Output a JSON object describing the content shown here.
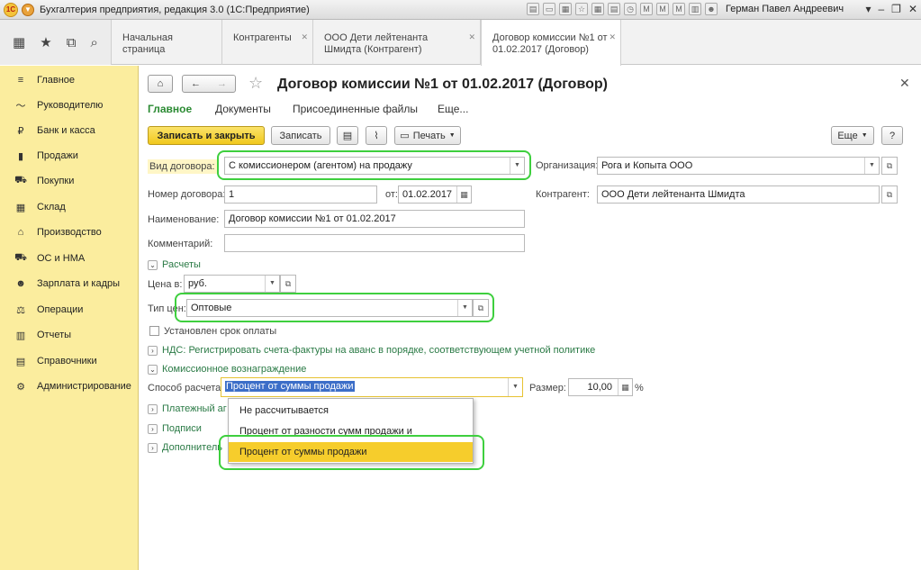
{
  "window": {
    "title": "Бухгалтерия предприятия, редакция 3.0  (1С:Предприятие)",
    "user": "Герман Павел Андреевич"
  },
  "tabs": [
    {
      "label": "Начальная страница"
    },
    {
      "label": "Контрагенты"
    },
    {
      "label": "ООО Дети лейтенанта Шмидта (Контрагент)"
    },
    {
      "label": "Договор комиссии №1 от 01.02.2017 (Договор)"
    }
  ],
  "sidebar": {
    "items": [
      {
        "label": "Главное",
        "icon": "≡"
      },
      {
        "label": "Руководителю",
        "icon": "〜"
      },
      {
        "label": "Банк и касса",
        "icon": "₽"
      },
      {
        "label": "Продажи",
        "icon": "▮"
      },
      {
        "label": "Покупки",
        "icon": "⛟"
      },
      {
        "label": "Склад",
        "icon": "▦"
      },
      {
        "label": "Производство",
        "icon": "⌂"
      },
      {
        "label": "ОС и НМА",
        "icon": "⛟"
      },
      {
        "label": "Зарплата и кадры",
        "icon": "☻"
      },
      {
        "label": "Операции",
        "icon": "⚖"
      },
      {
        "label": "Отчеты",
        "icon": "▥"
      },
      {
        "label": "Справочники",
        "icon": "▤"
      },
      {
        "label": "Администрирование",
        "icon": "⚙"
      }
    ]
  },
  "form": {
    "title": "Договор комиссии №1 от 01.02.2017 (Договор)",
    "tabs": [
      "Главное",
      "Документы",
      "Присоединенные файлы",
      "Еще..."
    ],
    "toolbar": {
      "save_close": "Записать и закрыть",
      "save": "Записать",
      "print": "Печать",
      "more": "Еще",
      "help": "?"
    },
    "contract_type": {
      "label": "Вид договора:",
      "value": "С комиссионером (агентом) на продажу"
    },
    "organization": {
      "label": "Организация:",
      "value": "Рога и Копыта ООО"
    },
    "number": {
      "label": "Номер договора:",
      "value": "1"
    },
    "date": {
      "label": "от:",
      "value": "01.02.2017"
    },
    "counterparty": {
      "label": "Контрагент:",
      "value": "ООО Дети лейтенанта Шмидта"
    },
    "name": {
      "label": "Наименование:",
      "value": "Договор комиссии №1 от 01.02.2017"
    },
    "comment": {
      "label": "Комментарий:",
      "value": ""
    },
    "group_settlements": "Расчеты",
    "price_in": {
      "label": "Цена в:",
      "value": "руб."
    },
    "price_type": {
      "label": "Тип цен:",
      "value": "Оптовые"
    },
    "payment_term": "Установлен срок оплаты",
    "group_vat": "НДС: Регистрировать счета-фактуры на аванс в порядке, соответствующем учетной политике",
    "group_commission": "Комиссионное вознаграждение",
    "calc_method": {
      "label": "Способ расчета:",
      "value": "Процент от суммы продажи"
    },
    "size": {
      "label": "Размер:",
      "value": "10,00",
      "unit": "%"
    },
    "group_payment_agent": "Платежный аг",
    "group_signatures": "Подписи",
    "group_additional": "Дополнитель",
    "dropdown_options": [
      "Не рассчитывается",
      "Процент от разности сумм продажи и поступления",
      "Процент от суммы продажи"
    ]
  },
  "colors": {
    "sidebar_bg": "#fbed9e",
    "primary_button": "#f0c81d",
    "highlight": "#3ecf3e",
    "active_tab_text": "#2a8a32",
    "group_text": "#2a7a45"
  }
}
